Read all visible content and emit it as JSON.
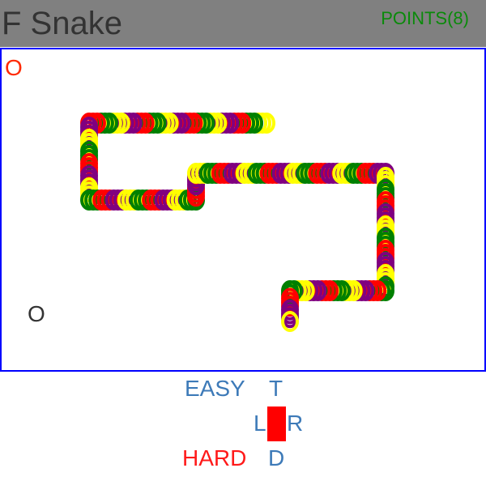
{
  "header": {
    "title": "F Snake",
    "points": "POINTS(8)"
  },
  "board": {
    "food_top": "O",
    "food_bottom": "O",
    "snake_colors": [
      "#ffff00",
      "#008000",
      "#ff0000",
      "#800080"
    ]
  },
  "controls": {
    "easy": "EASY",
    "up": "T",
    "left": "L",
    "right": "R",
    "hard": "HARD",
    "down": "D"
  }
}
